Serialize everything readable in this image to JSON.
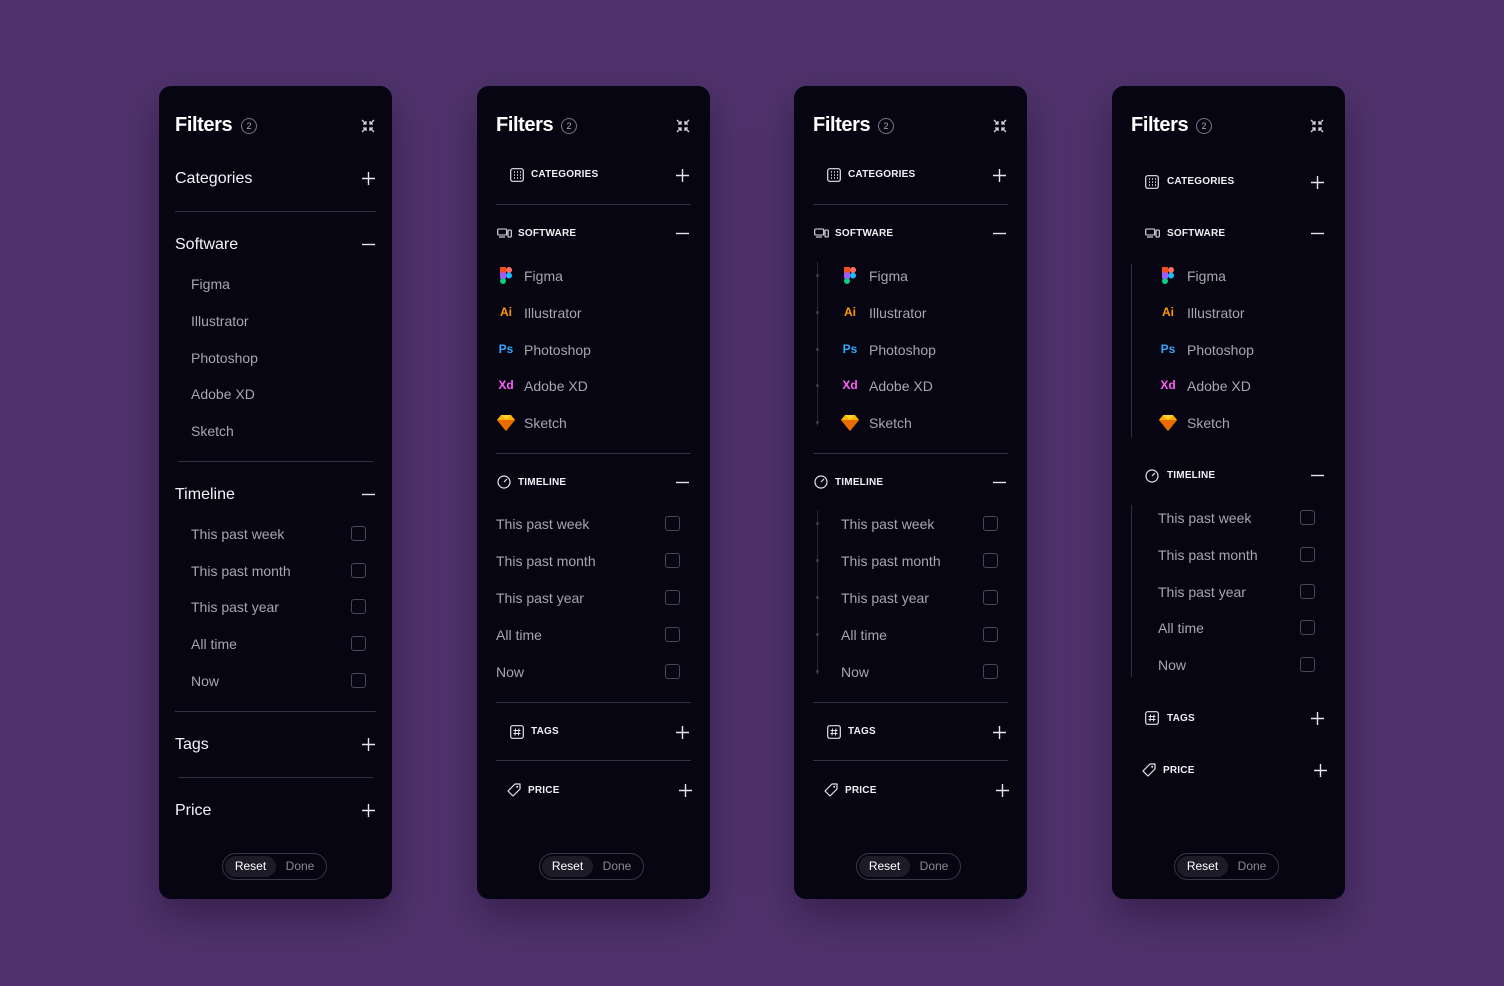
{
  "colors": {
    "background": "#4f326b",
    "panel": "#080513",
    "illustrator": "#ff9a00",
    "photoshop": "#31a8ff",
    "xd": "#ff61f6",
    "sketch": "#fdb300"
  },
  "panels": [
    {
      "variant": "plain",
      "title": "Filters",
      "badge": "2",
      "sections": {
        "categories": {
          "label": "Categories",
          "icon": "plus-icon"
        },
        "software": {
          "label": "Software",
          "icon": "minus-icon",
          "items": [
            "Figma",
            "Illustrator",
            "Photoshop",
            "Adobe XD",
            "Sketch"
          ]
        },
        "timeline": {
          "label": "Timeline",
          "icon": "minus-icon",
          "items": [
            "This past week",
            "This past month",
            "This past year",
            "All time",
            "Now"
          ]
        },
        "tags": {
          "label": "Tags",
          "icon": "plus-icon"
        },
        "price": {
          "label": "Price",
          "icon": "plus-icon"
        }
      },
      "footer": {
        "reset": "Reset",
        "done": "Done"
      }
    },
    {
      "variant": "icons",
      "title": "Filters",
      "badge": "2",
      "sections": {
        "categories": {
          "label": "CATEGORIES",
          "icon": "grid-icon"
        },
        "software": {
          "label": "SOFTWARE",
          "icon": "devices-icon",
          "items": [
            "Figma",
            "Illustrator",
            "Photoshop",
            "Adobe XD",
            "Sketch"
          ]
        },
        "timeline": {
          "label": "TIMELINE",
          "icon": "timer-icon",
          "items": [
            "This past week",
            "This past month",
            "This past year",
            "All time",
            "Now"
          ]
        },
        "tags": {
          "label": "TAGS",
          "icon": "hash-icon"
        },
        "price": {
          "label": "PRICE",
          "icon": "tag-icon"
        }
      },
      "footer": {
        "reset": "Reset",
        "done": "Done"
      }
    },
    {
      "variant": "dotted-tree",
      "title": "Filters",
      "badge": "2",
      "sections": {
        "categories": {
          "label": "CATEGORIES",
          "icon": "grid-icon"
        },
        "software": {
          "label": "SOFTWARE",
          "icon": "devices-icon",
          "items": [
            "Figma",
            "Illustrator",
            "Photoshop",
            "Adobe XD",
            "Sketch"
          ]
        },
        "timeline": {
          "label": "TIMELINE",
          "icon": "timer-icon",
          "items": [
            "This past week",
            "This past month",
            "This past year",
            "All time",
            "Now"
          ]
        },
        "tags": {
          "label": "TAGS",
          "icon": "hash-icon"
        },
        "price": {
          "label": "PRICE",
          "icon": "tag-icon"
        }
      },
      "footer": {
        "reset": "Reset",
        "done": "Done"
      }
    },
    {
      "variant": "line-tree",
      "title": "Filters",
      "badge": "2",
      "sections": {
        "categories": {
          "label": "CATEGORIES",
          "icon": "grid-icon"
        },
        "software": {
          "label": "SOFTWARE",
          "icon": "devices-icon",
          "items": [
            "Figma",
            "Illustrator",
            "Photoshop",
            "Adobe XD",
            "Sketch"
          ]
        },
        "timeline": {
          "label": "TIMELINE",
          "icon": "timer-icon",
          "items": [
            "This past week",
            "This past month",
            "This past year",
            "All time",
            "Now"
          ]
        },
        "tags": {
          "label": "TAGS",
          "icon": "hash-icon"
        },
        "price": {
          "label": "PRICE",
          "icon": "tag-icon"
        }
      },
      "footer": {
        "reset": "Reset",
        "done": "Done"
      }
    }
  ],
  "app_icons": {
    "figma": "figma-logo-icon",
    "illustrator": "Ai",
    "photoshop": "Ps",
    "xd": "Xd",
    "sketch": "sketch-diamond-icon"
  }
}
